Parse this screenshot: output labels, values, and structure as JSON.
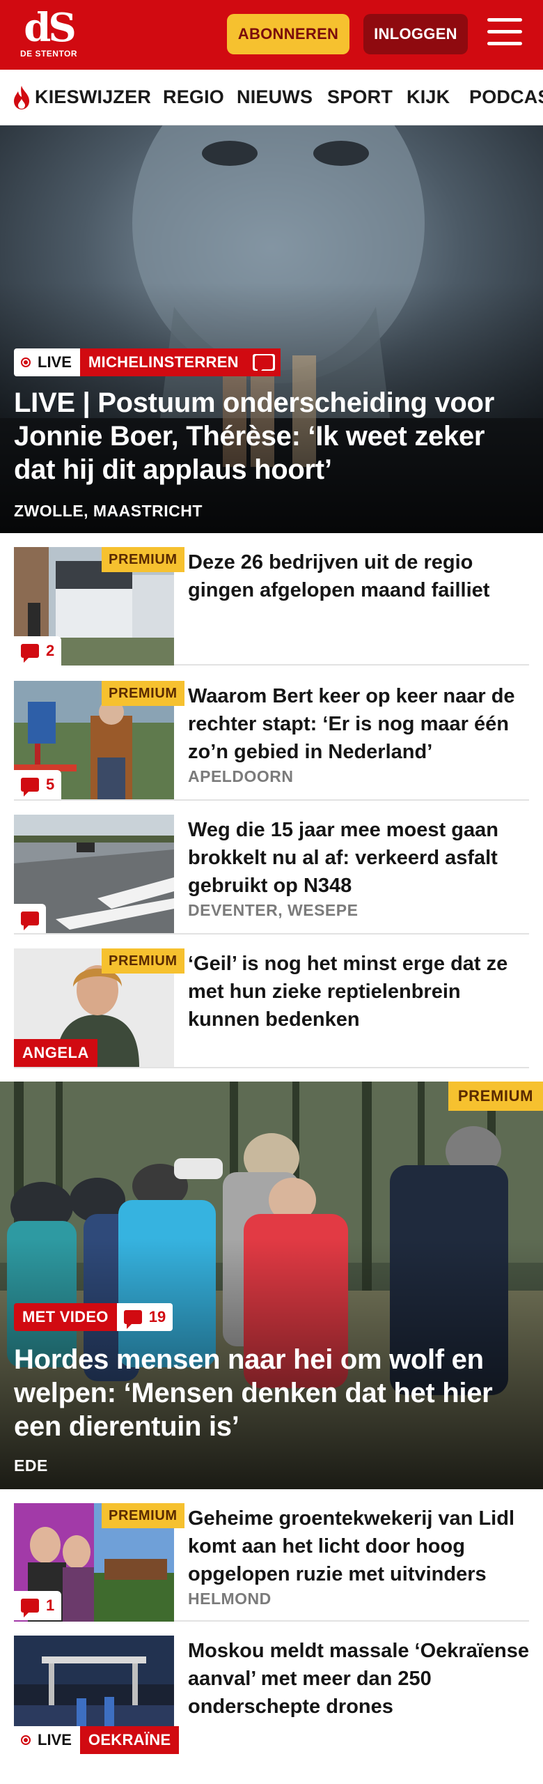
{
  "header": {
    "logo_mark": "dS",
    "logo_sub": "DE STENTOR",
    "subscribe_label": "ABONNEREN",
    "login_label": "INLOGGEN",
    "menu_icon": "hamburger-icon",
    "brand_color": "#d10a11",
    "accent_color": "#f6c12f"
  },
  "nav": {
    "items": [
      {
        "label": "KIESWIJZER",
        "icon": "flame-icon"
      },
      {
        "label": "REGIO"
      },
      {
        "label": "NIEUWS"
      },
      {
        "label": "SPORT"
      },
      {
        "label": "KIJK"
      },
      {
        "label": "PODCAS"
      }
    ]
  },
  "hero": {
    "live_label": "LIVE",
    "topic_label": "MICHELINSTERREN",
    "title": "LIVE | Postuum onderscheiding voor Jonnie Boer, Thérèse: ‘Ik weet zeker dat hij dit applaus hoort’",
    "location": "ZWOLLE, MAASTRICHT"
  },
  "articles": [
    {
      "title": "Deze 26 bedrijven uit de regio gingen afgelopen maand failliet",
      "premium": "PREMIUM",
      "comments": "2",
      "location": ""
    },
    {
      "title": "Waarom Bert keer op keer naar de rechter stapt: ‘Er is nog maar één zo’n gebied in Nederland’",
      "premium": "PREMIUM",
      "comments": "5",
      "location": "APELDOORN"
    },
    {
      "title": "Weg die 15 jaar mee moest gaan brokkelt nu al af: verkeerd asfalt gebruikt op N348",
      "premium": "",
      "comments": "",
      "location": "DEVENTER, WESEPE"
    },
    {
      "title": "‘Geil’ is nog het minst erge dat ze met hun zieke reptielenbrein kunnen bedenken",
      "premium": "PREMIUM",
      "tag": "ANGELA",
      "location": ""
    }
  ],
  "hero2": {
    "premium": "PREMIUM",
    "video_label": "MET VIDEO",
    "comments": "19",
    "title": "Hordes mensen naar hei om wolf en welpen: ‘Mensen denken dat het hier een dierentuin is’",
    "location": "EDE"
  },
  "articles2": [
    {
      "title": "Geheime groentekwekerij van Lidl komt aan het licht door hoog opgelopen ruzie met uitvinders",
      "premium": "PREMIUM",
      "comments": "1",
      "location": "HELMOND"
    },
    {
      "title": "Moskou meldt massale ‘Oekraïense aanval’ met meer dan 250 onderschepte drones",
      "live_label": "LIVE",
      "topic_label": "OEKRAÏNE",
      "location": ""
    }
  ]
}
